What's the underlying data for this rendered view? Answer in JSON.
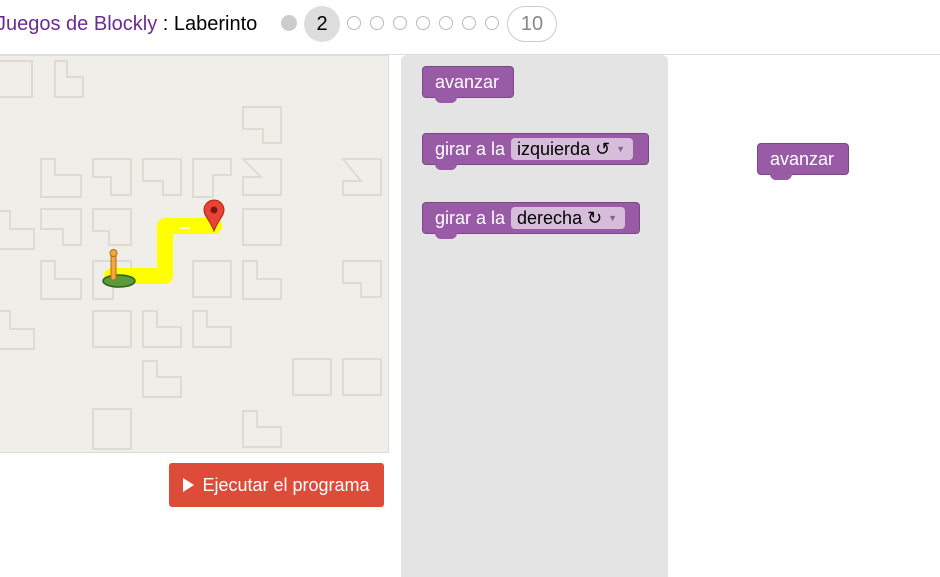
{
  "header": {
    "app_link": "Juegos de Blockly",
    "separator": " : ",
    "game_name": "Laberinto",
    "current_level": "2",
    "last_level": "10"
  },
  "run_button": {
    "label": "Ejecutar el programa"
  },
  "toolbox": {
    "move_label": "avanzar",
    "turn_left_prefix": "girar a la",
    "turn_left_value": "izquierda ↺",
    "turn_right_prefix": "girar a la",
    "turn_right_value": "derecha ↻"
  },
  "workspace": {
    "move_label": "avanzar"
  },
  "colors": {
    "block": "#995ba5",
    "run": "#dd4b39",
    "path": "#ffff00",
    "link": "#6b2c91"
  },
  "icons": [
    "play-icon",
    "marker-icon",
    "pegman-icon",
    "dropdown-arrow-icon"
  ]
}
